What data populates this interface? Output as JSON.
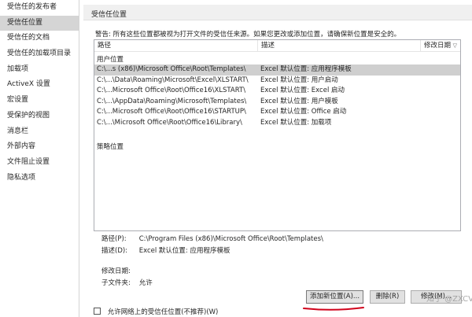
{
  "sidebar": {
    "items": [
      {
        "label": "受信任的发布者",
        "active": false
      },
      {
        "label": "受信任位置",
        "active": true
      },
      {
        "label": "受信任的文档",
        "active": false
      },
      {
        "label": "受信任的加载项目录",
        "active": false
      },
      {
        "label": "加载项",
        "active": false
      },
      {
        "label": "ActiveX 设置",
        "active": false
      },
      {
        "label": "宏设置",
        "active": false
      },
      {
        "label": "受保护的视图",
        "active": false
      },
      {
        "label": "消息栏",
        "active": false
      },
      {
        "label": "外部内容",
        "active": false
      },
      {
        "label": "文件阻止设置",
        "active": false
      },
      {
        "label": "隐私选项",
        "active": false
      }
    ]
  },
  "main": {
    "title": "受信任位置",
    "warning": "警告: 所有这些位置都被视为打开文件的受信任来源。如果您更改或添加位置，请确保新位置是安全的。",
    "table": {
      "headers": {
        "path": "路径",
        "desc": "描述",
        "date": "修改日期",
        "sort_icon": "▽"
      },
      "user_group": "用户位置",
      "policy_group": "策略位置",
      "rows": [
        {
          "path": "C:\\...s (x86)\\Microsoft Office\\Root\\Templates\\",
          "desc": "Excel 默认位置: 应用程序模板",
          "selected": true
        },
        {
          "path": "C:\\...\\Data\\Roaming\\Microsoft\\Excel\\XLSTART\\",
          "desc": "Excel 默认位置: 用户启动",
          "selected": false
        },
        {
          "path": "C:\\...Microsoft Office\\Root\\Office16\\XLSTART\\",
          "desc": "Excel 默认位置: Excel 启动",
          "selected": false
        },
        {
          "path": "C:\\...\\AppData\\Roaming\\Microsoft\\Templates\\",
          "desc": "Excel 默认位置: 用户模板",
          "selected": false
        },
        {
          "path": "C:\\...Microsoft Office\\Root\\Office16\\STARTUP\\",
          "desc": "Excel 默认位置: Office 启动",
          "selected": false
        },
        {
          "path": "C:\\...\\Microsoft Office\\Root\\Office16\\Library\\",
          "desc": "Excel 默认位置: 加载项",
          "selected": false
        }
      ]
    },
    "details": {
      "path_label": "路径(P):",
      "path_value": "C:\\Program Files (x86)\\Microsoft Office\\Root\\Templates\\",
      "desc_label": "描述(D):",
      "desc_value": "Excel 默认位置: 应用程序模板",
      "date_label": "修改日期:",
      "date_value": "",
      "subfolder_label": "子文件夹:",
      "subfolder_value": "允许"
    },
    "buttons": {
      "add": "添加新位置(A)...",
      "remove": "删除(R)",
      "modify": "修改(M)..."
    },
    "checkbox": {
      "label": "允许网络上的受信任位置(不推荐)(W)",
      "checked": false
    },
    "watermark": "知乎 @ZXCV"
  },
  "colors": {
    "selected_row": "#cfcfcf",
    "sidebar_active": "#d5d5d5",
    "header_bg": "#f0f0f0",
    "annotation_red": "#d0021b"
  }
}
